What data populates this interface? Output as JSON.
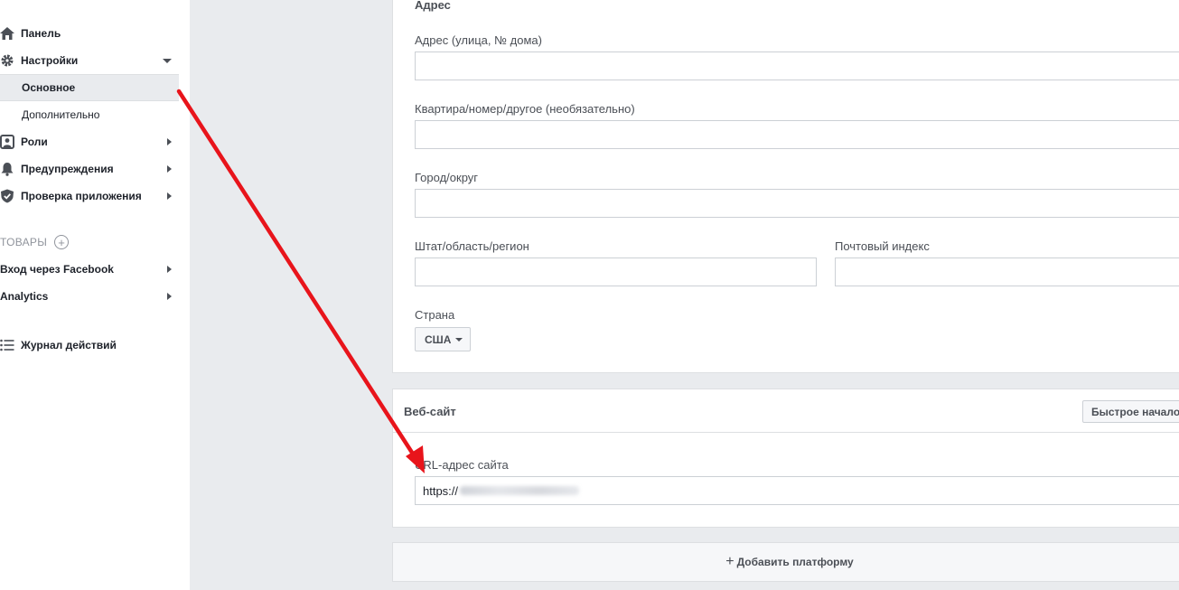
{
  "sidebar": {
    "items": [
      {
        "label": "Панель",
        "icon": "home-icon"
      },
      {
        "label": "Настройки",
        "icon": "gear-icon"
      },
      {
        "label": "Основное"
      },
      {
        "label": "Дополнительно"
      },
      {
        "label": "Роли",
        "icon": "roles-icon"
      },
      {
        "label": "Предупреждения",
        "icon": "bell-icon"
      },
      {
        "label": "Проверка приложения",
        "icon": "shield-icon"
      }
    ],
    "products_label": "ТОВАРЫ",
    "products": [
      {
        "label": "Вход через Facebook"
      },
      {
        "label": "Analytics"
      }
    ],
    "activity_log": {
      "label": "Журнал действий",
      "icon": "list-icon"
    }
  },
  "address": {
    "title": "Адрес",
    "street_label": "Адрес (улица, № дома)",
    "street_value": "",
    "apt_label": "Квартира/номер/другое (необязательно)",
    "apt_value": "",
    "city_label": "Город/округ",
    "city_value": "",
    "state_label": "Штат/область/регион",
    "state_value": "",
    "zip_label": "Почтовый индекс",
    "zip_value": "",
    "country_label": "Страна",
    "country_value": "США"
  },
  "website": {
    "title": "Веб-сайт",
    "quick_start_label": "Быстрое начало р",
    "url_label": "URL-адрес сайта",
    "url_value": "https://"
  },
  "add_platform": {
    "label": "Добавить платформу"
  },
  "colors": {
    "annotation_arrow": "#e8141b",
    "background": "#e9ebee"
  }
}
